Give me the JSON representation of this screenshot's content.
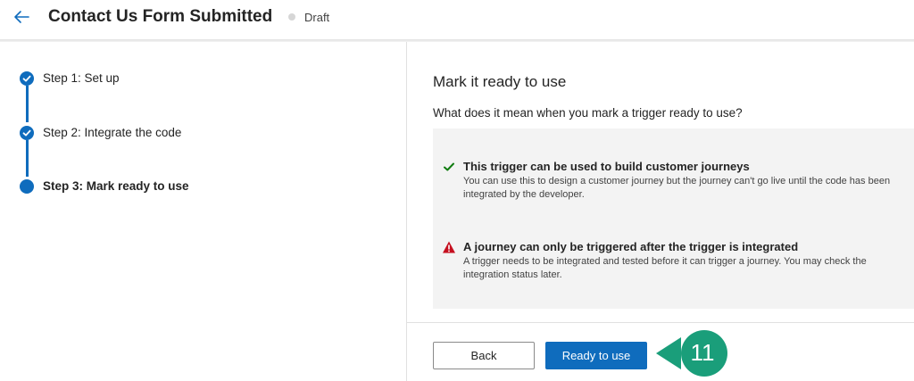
{
  "header": {
    "title": "Contact Us Form Submitted",
    "status": "Draft",
    "back_icon": "arrow-left-icon"
  },
  "steps": [
    {
      "label": "Step 1: Set up",
      "state": "completed"
    },
    {
      "label": "Step 2: Integrate the code",
      "state": "completed"
    },
    {
      "label": "Step 3: Mark ready to use",
      "state": "current"
    }
  ],
  "panel": {
    "title": "Mark it ready to use",
    "subtitle": "What does it mean when you mark a trigger ready to use?",
    "items": [
      {
        "icon": "checkmark-icon",
        "heading": "This trigger can be used to build customer journeys",
        "body": "You can use this to design a customer journey but the journey can't go live until the code has been integrated by the developer."
      },
      {
        "icon": "warning-icon",
        "heading": "A journey can only be triggered after the trigger is integrated",
        "body": "A trigger needs to be integrated and tested before it can trigger a journey. You may check the integration status later."
      }
    ]
  },
  "actions": {
    "back_label": "Back",
    "ready_label": "Ready to use"
  },
  "callout": {
    "number": "11",
    "color": "#1a9e7a"
  },
  "colors": {
    "accent": "#0f6cbd",
    "warning": "#c50f1f",
    "success": "#107c10"
  }
}
